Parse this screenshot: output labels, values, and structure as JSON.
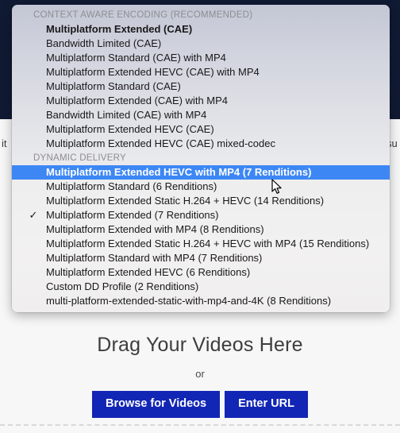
{
  "background": {
    "partial_text_left": "it",
    "partial_text_right": "su",
    "logo_name": "orange-circle-logo",
    "dropzone": {
      "title": "Drag Your Videos Here",
      "or_label": "or",
      "browse_button": "Browse for Videos",
      "url_button": "Enter URL"
    }
  },
  "colors": {
    "titlebar": "#101a33",
    "selection": "#3d87f5",
    "button": "#1226b5",
    "logo_orange": "#d2400f",
    "section_header_text": "#8d8d92"
  },
  "menu": {
    "name": "encoding-profile-menu",
    "sections": [
      {
        "header": "CONTEXT AWARE ENCODING (RECOMMENDED)",
        "items": [
          {
            "label": "Multiplatform Extended (CAE)",
            "checked": false,
            "selected": false,
            "bold": true
          },
          {
            "label": "Bandwidth Limited (CAE)",
            "checked": false,
            "selected": false,
            "bold": false
          },
          {
            "label": "Multiplatform Standard (CAE) with MP4",
            "checked": false,
            "selected": false,
            "bold": false
          },
          {
            "label": "Multiplatform Extended HEVC (CAE) with MP4",
            "checked": false,
            "selected": false,
            "bold": false
          },
          {
            "label": "Multiplatform Standard (CAE)",
            "checked": false,
            "selected": false,
            "bold": false
          },
          {
            "label": "Multiplatform Extended (CAE) with MP4",
            "checked": false,
            "selected": false,
            "bold": false
          },
          {
            "label": "Bandwidth Limited (CAE) with MP4",
            "checked": false,
            "selected": false,
            "bold": false
          },
          {
            "label": "Multiplatform Extended HEVC (CAE)",
            "checked": false,
            "selected": false,
            "bold": false
          },
          {
            "label": "Multiplatform Extended HEVC (CAE) mixed-codec",
            "checked": false,
            "selected": false,
            "bold": false
          }
        ]
      },
      {
        "header": "DYNAMIC DELIVERY",
        "items": [
          {
            "label": "Multiplatform Extended HEVC with MP4 (7 Renditions)",
            "checked": false,
            "selected": true,
            "bold": true
          },
          {
            "label": "Multiplatform Standard (6 Renditions)",
            "checked": false,
            "selected": false,
            "bold": false
          },
          {
            "label": "Multiplatform Extended Static H.264 + HEVC (14 Renditions)",
            "checked": false,
            "selected": false,
            "bold": false
          },
          {
            "label": "Multiplatform Extended (7 Renditions)",
            "checked": true,
            "selected": false,
            "bold": false
          },
          {
            "label": "Multiplatform Extended with MP4 (8 Renditions)",
            "checked": false,
            "selected": false,
            "bold": false
          },
          {
            "label": "Multiplatform Extended Static H.264 + HEVC with MP4 (15 Renditions)",
            "checked": false,
            "selected": false,
            "bold": false
          },
          {
            "label": "Multiplatform Standard with MP4 (7 Renditions)",
            "checked": false,
            "selected": false,
            "bold": false
          },
          {
            "label": "Multiplatform Extended HEVC (6 Renditions)",
            "checked": false,
            "selected": false,
            "bold": false
          },
          {
            "label": "Custom DD Profile (2 Renditions)",
            "checked": false,
            "selected": false,
            "bold": false
          },
          {
            "label": "multi-platform-extended-static-with-mp4-and-4K (8 Renditions)",
            "checked": false,
            "selected": false,
            "bold": false
          }
        ]
      }
    ],
    "checkmark_glyph": "✓"
  }
}
